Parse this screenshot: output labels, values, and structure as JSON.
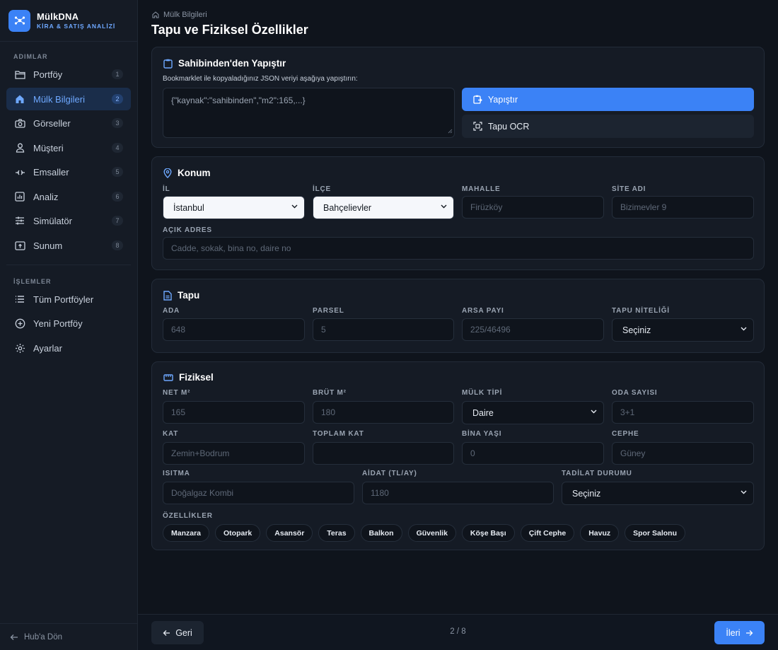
{
  "brand": {
    "name": "MülkDNA",
    "subtitle": "KİRA & SATIŞ ANALİZİ"
  },
  "sidebar": {
    "section_steps": "ADIMLAR",
    "steps": [
      {
        "label": "Portföy",
        "num": "1",
        "icon": "folder-icon"
      },
      {
        "label": "Mülk Bilgileri",
        "num": "2",
        "icon": "home-icon",
        "active": true
      },
      {
        "label": "Görseller",
        "num": "3",
        "icon": "camera-icon"
      },
      {
        "label": "Müşteri",
        "num": "4",
        "icon": "user-icon"
      },
      {
        "label": "Emsaller",
        "num": "5",
        "icon": "compare-icon"
      },
      {
        "label": "Analiz",
        "num": "6",
        "icon": "chart-icon"
      },
      {
        "label": "Simülatör",
        "num": "7",
        "icon": "sliders-icon"
      },
      {
        "label": "Sunum",
        "num": "8",
        "icon": "presentation-icon"
      }
    ],
    "section_actions": "İŞLEMLER",
    "actions": [
      {
        "label": "Tüm Portföyler",
        "icon": "list-icon"
      },
      {
        "label": "Yeni Portföy",
        "icon": "plus-circle-icon"
      },
      {
        "label": "Ayarlar",
        "icon": "gear-icon"
      }
    ],
    "back_label": "Hub'a Dön"
  },
  "breadcrumb": "Mülk Bilgileri",
  "page_title": "Tapu ve Fiziksel Özellikler",
  "paste": {
    "title": "Sahibinden'den Yapıştır",
    "hint": "Bookmarklet ile kopyaladığınız JSON veriyi aşağıya yapıştırın:",
    "textarea_placeholder": "{\"kaynak\":\"sahibinden\",\"m2\":165,...}",
    "paste_button": "Yapıştır",
    "ocr_button": "Tapu OCR"
  },
  "location": {
    "title": "Konum",
    "il_label": "İL",
    "il_value": "İstanbul",
    "ilce_label": "İLÇE",
    "ilce_value": "Bahçelievler",
    "mahalle_label": "MAHALLE",
    "mahalle_placeholder": "Firüzköy",
    "site_label": "SİTE ADI",
    "site_placeholder": "Bizimevler 9",
    "address_label": "AÇIK ADRES",
    "address_placeholder": "Cadde, sokak, bina no, daire no"
  },
  "deed": {
    "title": "Tapu",
    "ada_label": "ADA",
    "ada_value": "648",
    "parsel_label": "PARSEL",
    "parsel_value": "5",
    "arsa_label": "ARSA PAYI",
    "arsa_value": "225/46496",
    "nitelik_label": "TAPU NİTELİĞİ",
    "nitelik_value": "Seçiniz"
  },
  "physical": {
    "title": "Fiziksel",
    "net_label": "NET M²",
    "net_value": "165",
    "brut_label": "BRÜT M²",
    "brut_value": "180",
    "tip_label": "MÜLK TİPİ",
    "tip_value": "Daire",
    "oda_label": "ODA SAYISI",
    "oda_value": "3+1",
    "kat_label": "KAT",
    "kat_value": "Zemin+Bodrum",
    "toplam_label": "TOPLAM KAT",
    "toplam_value": "",
    "yas_label": "BİNA YAŞI",
    "yas_value": "0",
    "cephe_label": "CEPHE",
    "cephe_value": "Güney",
    "isitma_label": "ISITMA",
    "isitma_value": "Doğalgaz Kombi",
    "aidat_label": "AİDAT (TL/AY)",
    "aidat_value": "1180",
    "tadilat_label": "TADİLAT DURUMU",
    "tadilat_value": "Seçiniz",
    "features_label": "ÖZELLİKLER",
    "features": [
      "Manzara",
      "Otopark",
      "Asansör",
      "Teras",
      "Balkon",
      "Güvenlik",
      "Köşe Başı",
      "Çift Cephe",
      "Havuz",
      "Spor Salonu"
    ]
  },
  "footer": {
    "back": "Geri",
    "pager": "2 / 8",
    "next": "İleri"
  },
  "colors": {
    "accent": "#3b82f6",
    "background": "#0f141c",
    "panel": "#151b25"
  }
}
